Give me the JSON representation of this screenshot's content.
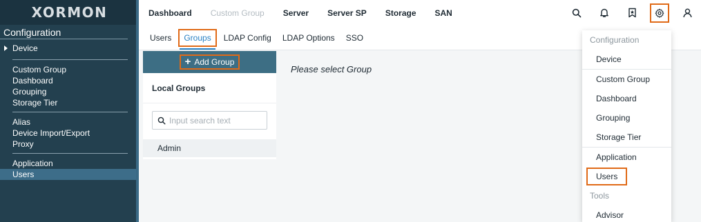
{
  "app": {
    "logo": "XORMON"
  },
  "sidebar": {
    "section_title": "Configuration",
    "device_label": "Device",
    "group1": [
      "Custom Group",
      "Dashboard",
      "Grouping",
      "Storage Tier"
    ],
    "group2": [
      "Alias",
      "Device Import/Export",
      "Proxy"
    ],
    "group3": [
      "Application",
      "Users"
    ],
    "active_item": "Users"
  },
  "topnav": {
    "items": [
      "Dashboard",
      "Custom Group",
      "Server",
      "Server SP",
      "Storage",
      "SAN"
    ],
    "disabled_item": "Custom Group",
    "icons": [
      "search-icon",
      "bell-icon",
      "bookmark-icon",
      "gear-icon",
      "user-icon"
    ]
  },
  "tabs": {
    "items": [
      "Users",
      "Groups",
      "LDAP Config",
      "LDAP Options",
      "SSO"
    ],
    "active": "Groups"
  },
  "groups_panel": {
    "add_button": "Add Group",
    "title": "Local Groups",
    "search_placeholder": "Input search text",
    "rows": [
      "Admin"
    ]
  },
  "main": {
    "hint": "Please select Group"
  },
  "dropdown": {
    "header_config": "Configuration",
    "device": "Device",
    "items1": [
      "Custom Group",
      "Dashboard",
      "Grouping",
      "Storage Tier"
    ],
    "application": "Application",
    "users": "Users",
    "header_tools": "Tools",
    "advisor": "Advisor"
  },
  "colors": {
    "sidebar_bg": "#23404f",
    "accent": "#2a82c4",
    "highlight_outline": "#e06a17",
    "add_bar": "#3d6e84"
  }
}
